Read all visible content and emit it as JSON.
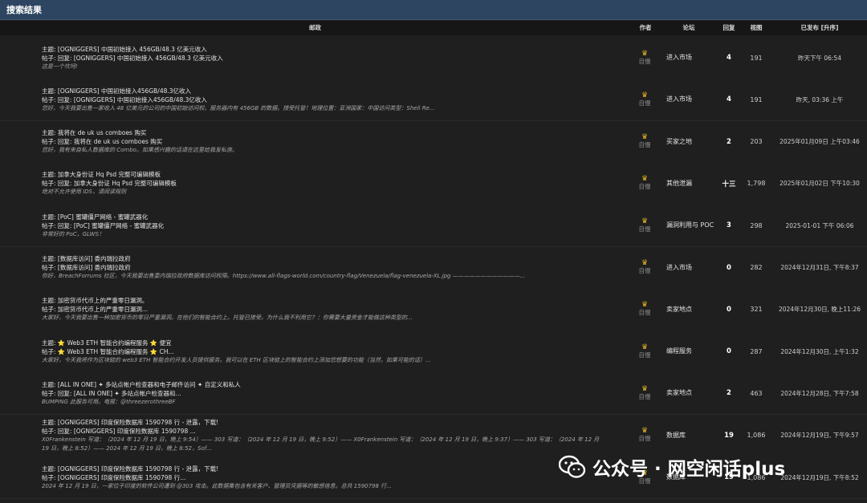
{
  "title": "搜索结果",
  "columns": {
    "post": "邮政",
    "author": "作者",
    "forum": "论坛",
    "replies": "回复",
    "views": "视图",
    "posted": "已发布 [升序]"
  },
  "rows": [
    {
      "subject_line": "主题: [OGNIGGERS] 中国初始接入 456GB/48.3 亿美元收入",
      "post_line": "帖子: 回复: [OGNIGGERS] 中国初始接入 456GB/48.3 亿美元收入",
      "preview": "这是一个坎坷!",
      "author": "自慢",
      "forum": "进入市场",
      "replies": "4",
      "views": "191",
      "date": "昨天下午 06:54"
    },
    {
      "subject_line": "主题: [OGNIGGERS] 中国初始接入456GB/48.3亿收入",
      "post_line": "帖子: 回复: [OGNIGGERS] 中国初始接入456GB/48.3亿收入",
      "preview": "您好，今天我要出售一家收入 48 亿美元的公司的中国初始访问权。服务器内有 456GB 的数据。接受托管！地理位置：亚洲国家：中国访问类型：Shell Re...",
      "author": "自慢",
      "forum": "进入市场",
      "replies": "4",
      "views": "191",
      "date": "昨天, 03:36 上午"
    },
    {
      "subject_line": "主题: 我将在 de uk us comboes 购买",
      "post_line": "帖子: 回复: 我将在 de uk us comboes 购买",
      "preview": "您好，我有来自私人数据库的 Combo。如果感兴趣的话请在这里给我发私信。",
      "author": "自慢",
      "forum": "买家之地",
      "replies": "2",
      "views": "203",
      "date": "2025年01月09日 上午03:46"
    },
    {
      "subject_line": "主题: 加拿大身份证 Hq Psd 完整可编辑模板",
      "post_line": "帖子: 回复: 加拿大身份证 Hq Psd 完整可编辑模板",
      "preview": "绝对不允许使用 IDS，请阅读规则",
      "author": "自慢",
      "forum": "其他泄漏",
      "replies": "十三",
      "views": "1,798",
      "date": "2025年01月02日 下午10:30"
    },
    {
      "subject_line": "主题: [PoC] 蜜罐僵尸网络 - 蜜罐武器化",
      "post_line": "帖子: 回复: [PoC] 蜜罐僵尸网络 - 蜜罐武器化",
      "preview": "非常好的 PoC，GLWS！",
      "author": "自慢",
      "forum": "漏洞利用与 POC",
      "replies": "3",
      "views": "298",
      "date": "2025-01-01 下午 06:06"
    },
    {
      "subject_line": "主题: [数据库访问] 委内瑞拉政府",
      "post_line": "帖子: [数据库访问] 委内瑞拉政府",
      "preview": "你好，BreachForrums 社区，今天我要出售委内瑞拉政府数据库访问权限。https://www.all-flags-world.com/country-flag/Venezuela/flag-venezuela-XL.jpg ————————————...",
      "author": "自慢",
      "forum": "进入市场",
      "replies": "0",
      "views": "282",
      "date": "2024年12月31日, 下午8:37"
    },
    {
      "subject_line": "主题: 加密货币代币上的严重零日漏洞。",
      "post_line": "帖子: 加密货币代币上的严重零日漏洞...",
      "preview": "大家好，今天我要出售一种加密货币的零日严重漏洞。在他们的智能合约上。托管已接受。为什么我不利用它？：你需要大量资金才能做这种类型的...",
      "author": "自慢",
      "forum": "卖家地点",
      "replies": "0",
      "views": "321",
      "date": "2024年12月30日, 晚上11:26"
    },
    {
      "subject_line": "主题: ⭐ Web3 ETH 智能合约编程服务 ⭐ 便宜",
      "post_line": "帖子: ⭐ Web3 ETH 智能合约编程服务 ⭐ CH...",
      "preview": "大家好，今天我将作为区块链的 web3 ETH 智能合约开发人员提供服务。我可以在 ETH 区块链上的智能合约上添加您想要的功能（当然，如果可能的话）...",
      "author": "自慢",
      "forum": "编程服务",
      "replies": "0",
      "views": "287",
      "date": "2024年12月30日, 上午1:32"
    },
    {
      "subject_line": "主题: [ALL IN ONE] ✦ 多站点帐户检查器和电子邮件访问 ✦ 自定义和私人",
      "post_line": "帖子: 回复: [ALL IN ONE] ✦ 多站点帐户检查器和...",
      "preview": "BUMPING 此服务可用。电报：@threezerothreeBF",
      "author": "自慢",
      "forum": "卖家地点",
      "replies": "2",
      "views": "463",
      "date": "2024年12月28日, 下午7:58"
    },
    {
      "subject_line": "主题: [OGNIGGERS] 印度保险数据库 1590798 行 - 泄露，下载!",
      "post_line": "帖子: 回复: [OGNIGGERS] 印度保险数据库 1590798 ...",
      "preview": "X0Frankenstein 写道：（2024 年 12 月 19 日，晚上 9:54）—— 303 写道：（2024 年 12 月 19 日，晚上 9:52）—— X0Frankenstein 写道：（2024 年 12 月 19 日，晚上 9:37）—— 303 写道：（2024 年 12 月",
      "preview2": "19 日，晚上 8:52）—— 2024 年 12 月 19 日，晚上 8:52，Sof...",
      "author": "自慢",
      "forum": "数据库",
      "replies": "19",
      "views": "1,086",
      "date": "2024年12月19日, 下午9:57"
    },
    {
      "subject_line": "主题: [OGNIGGERS] 印度保险数据库 1590798 行 - 泄露，下载!",
      "post_line": "帖子: [OGNIGGERS] 印度保险数据库 1590798 行...",
      "preview": "2024 年 12 月 19 日，一家位于印度的软件公司遭到 @303 攻击。此数据集包含有关客户、管理员凭据等的敏感信息。总共 1590798 行...",
      "author": "自慢",
      "forum": "数据库",
      "replies": "19",
      "views": "1,086",
      "date": "2024年12月19日, 下午8:52"
    }
  ],
  "watermark": "公众号 · 网空闲话plus",
  "colors": {
    "title_bar": "#2d4560",
    "background": "#1f1f1f",
    "crown": "#e8b923"
  }
}
